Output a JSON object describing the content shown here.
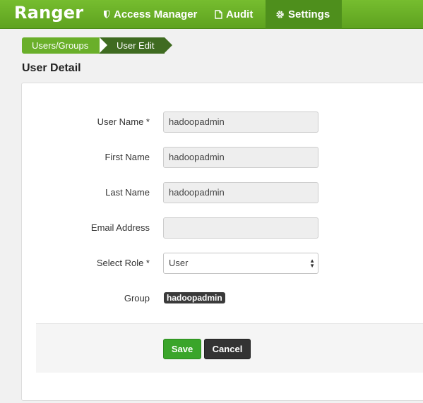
{
  "navbar": {
    "brand": "Ranger",
    "items": [
      {
        "label": "Access Manager",
        "icon": "shield-icon"
      },
      {
        "label": "Audit",
        "icon": "file-icon"
      },
      {
        "label": "Settings",
        "icon": "gear-icon",
        "active": true
      }
    ]
  },
  "breadcrumb": [
    "Users/Groups",
    "User Edit"
  ],
  "page": {
    "title": "User Detail"
  },
  "form": {
    "user_name": {
      "label": "User Name *",
      "value": "hadoopadmin"
    },
    "first_name": {
      "label": "First Name",
      "value": "hadoopadmin"
    },
    "last_name": {
      "label": "Last Name",
      "value": "hadoopadmin"
    },
    "email": {
      "label": "Email Address",
      "value": ""
    },
    "role": {
      "label": "Select Role *",
      "value": "User"
    },
    "group": {
      "label": "Group",
      "badge": "hadoopadmin"
    }
  },
  "actions": {
    "save": "Save",
    "cancel": "Cancel"
  },
  "colors": {
    "nav_green": "#6bb12a",
    "nav_active": "#4e8f1c",
    "save_green": "#3aa52a",
    "cancel_dark": "#333333"
  }
}
